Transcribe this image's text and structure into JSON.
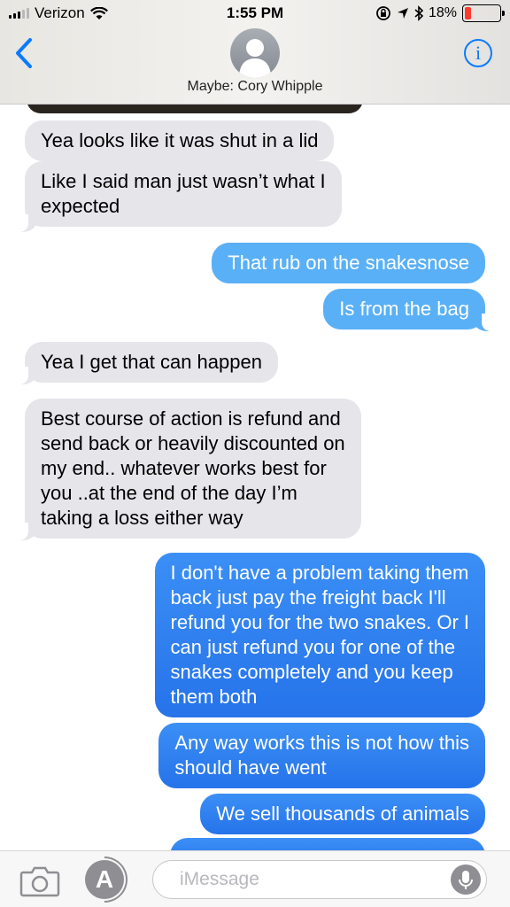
{
  "status_bar": {
    "carrier": "Verizon",
    "time": "1:55 PM",
    "battery_percent": "18%",
    "battery_level": 0.18
  },
  "header": {
    "contact_name": "Maybe: Cory Whipple",
    "info_label": "i"
  },
  "messages": [
    {
      "direction": "incoming",
      "lines": [
        "Yea looks like it was shut in a lid"
      ]
    },
    {
      "direction": "incoming",
      "lines": [
        "Like I said man just wasn’t what I",
        "expected"
      ]
    },
    {
      "direction": "outgoing",
      "lines": [
        "That rub on the snakesnose"
      ]
    },
    {
      "direction": "outgoing",
      "lines": [
        "Is from the bag"
      ]
    },
    {
      "direction": "incoming",
      "lines": [
        "Yea I get that can happen"
      ]
    },
    {
      "direction": "incoming",
      "lines": [
        "Best course of action is refund  and",
        "send back or heavily discounted on",
        "my end.. whatever works best for",
        "you ..at the end of the day I’m",
        "taking a loss either way"
      ]
    },
    {
      "direction": "outgoing",
      "lines": [
        "I don't have a problem taking them",
        "back just pay the freight back I'll",
        "refund you for the two snakes. Or I",
        "can just refund you for one of the",
        "snakes completely and you keep",
        "them both"
      ]
    },
    {
      "direction": "outgoing",
      "lines": [
        "Any way works this is not how this",
        "should have went"
      ]
    },
    {
      "direction": "outgoing",
      "lines": [
        "We sell thousands of animals"
      ]
    }
  ],
  "input_bar": {
    "placeholder": "iMessage",
    "apps_label": "A"
  },
  "colors": {
    "imessage_blue": "#2673ea",
    "incoming_gray": "#e5e5ea",
    "link_blue": "#0a7bff"
  }
}
